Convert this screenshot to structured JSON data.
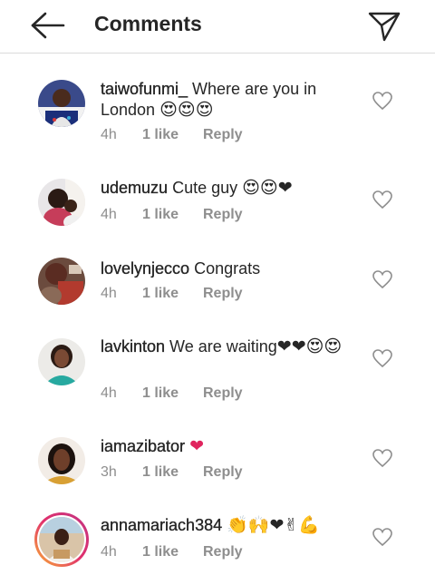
{
  "header": {
    "title": "Comments",
    "back_icon": "arrow-left-icon",
    "send_icon": "paper-plane-icon"
  },
  "comments": [
    {
      "username": "taiwofunmi_",
      "text": " Where are you in London ",
      "emoji": "😍😍😍",
      "time": "4h",
      "likes": "1 like",
      "reply": "Reply"
    },
    {
      "username": "udemuzu",
      "text": " Cute  guy ",
      "emoji": "😍😍❤",
      "time": "4h",
      "likes": "1 like",
      "reply": "Reply"
    },
    {
      "username": "lovelynjecco",
      "text": " Congrats",
      "emoji": "",
      "time": "4h",
      "likes": "1 like",
      "reply": "Reply"
    },
    {
      "username": "lavkinton",
      "text": " We are waiting",
      "emoji": "❤❤😍😍",
      "time": "4h",
      "likes": "1 like",
      "reply": "Reply"
    },
    {
      "username": "iamazibator",
      "text": " ",
      "emoji": "❤",
      "time": "3h",
      "likes": "1 like",
      "reply": "Reply"
    },
    {
      "username": "annamariach384",
      "text": " ",
      "emoji": "👏🙌❤✌💪",
      "time": "4h",
      "likes": "1 like",
      "reply": "Reply"
    }
  ],
  "colors": {
    "text": "#262626",
    "secondary": "#8e8e8e",
    "heart_emoji": "#e0245e",
    "story_ring": "#e1306c"
  }
}
